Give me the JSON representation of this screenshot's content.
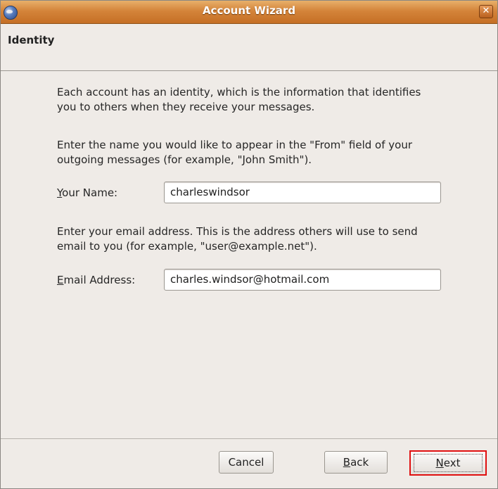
{
  "window": {
    "title": "Account Wizard",
    "close_glyph": "✕"
  },
  "page": {
    "title": "Identity"
  },
  "intro": {
    "line1": "Each account has an identity, which is the information that identifies",
    "line2": "you to others when they receive your messages."
  },
  "name_section": {
    "help_line1": "Enter the name you would like to appear in the \"From\" field of your",
    "help_line2": "outgoing messages (for example, \"John Smith\").",
    "label_mnemonic": "Y",
    "label_rest": "our Name:",
    "value": "charleswindsor"
  },
  "email_section": {
    "help_line1": "Enter your email address. This is the address others will use to send",
    "help_line2": "email to you (for example, \"user@example.net\").",
    "label_mnemonic": "E",
    "label_rest": "mail Address:",
    "value": "charles.windsor@hotmail.com"
  },
  "buttons": {
    "cancel": "Cancel",
    "back_mnemonic": "B",
    "back_rest": "ack",
    "next_mnemonic": "N",
    "next_rest": "ext"
  },
  "colors": {
    "titlebar": "#d4843a",
    "highlight": "#e01010"
  }
}
